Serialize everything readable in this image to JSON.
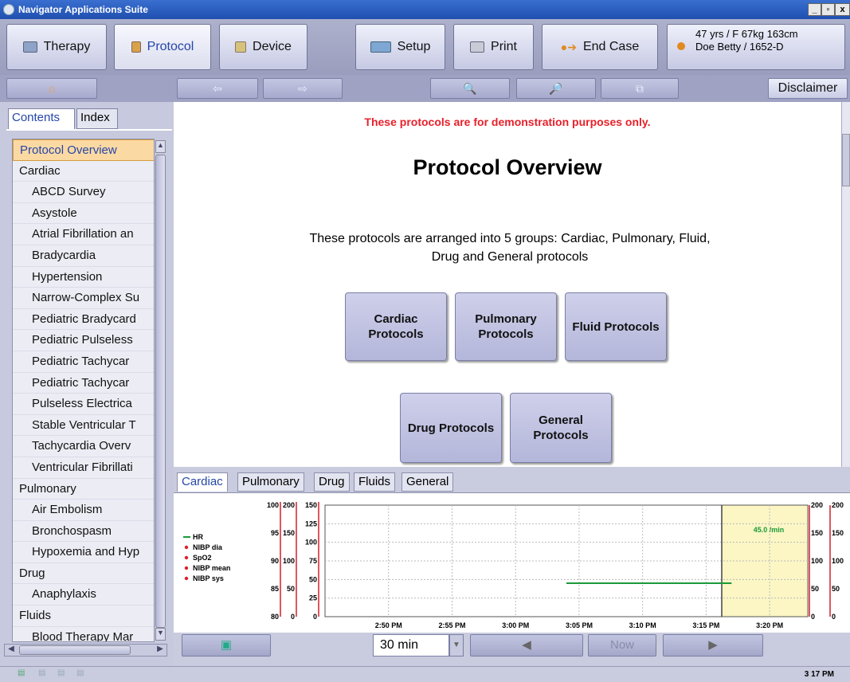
{
  "window": {
    "title": "Navigator Applications Suite"
  },
  "toolbar": {
    "therapy": "Therapy",
    "protocol": "Protocol",
    "device": "Device",
    "setup": "Setup",
    "print": "Print",
    "end_case": "End Case"
  },
  "patient": {
    "line1": "47 yrs / F  67kg  163cm",
    "line2": "Doe Betty / 1652-D"
  },
  "nav": {
    "disclaimer": "Disclaimer"
  },
  "left_tabs": {
    "contents": "Contents",
    "index": "Index"
  },
  "tree": [
    {
      "label": "Protocol Overview",
      "level": 0,
      "selected": true
    },
    {
      "label": "Cardiac",
      "level": 0
    },
    {
      "label": "ABCD Survey",
      "level": 1
    },
    {
      "label": "Asystole",
      "level": 1
    },
    {
      "label": "Atrial Fibrillation an",
      "level": 1
    },
    {
      "label": "Bradycardia",
      "level": 1
    },
    {
      "label": "Hypertension",
      "level": 1
    },
    {
      "label": "Narrow-Complex Su",
      "level": 1
    },
    {
      "label": "Pediatric Bradycard",
      "level": 1
    },
    {
      "label": "Pediatric Pulseless",
      "level": 1
    },
    {
      "label": "Pediatric Tachycar",
      "level": 1
    },
    {
      "label": "Pediatric Tachycar",
      "level": 1
    },
    {
      "label": "Pulseless Electrica",
      "level": 1
    },
    {
      "label": "Stable Ventricular T",
      "level": 1
    },
    {
      "label": "Tachycardia Overv",
      "level": 1
    },
    {
      "label": "Ventricular Fibrillati",
      "level": 1
    },
    {
      "label": "Pulmonary",
      "level": 0
    },
    {
      "label": "Air Embolism",
      "level": 1
    },
    {
      "label": "Bronchospasm",
      "level": 1
    },
    {
      "label": "Hypoxemia and Hyp",
      "level": 1
    },
    {
      "label": "Drug",
      "level": 0
    },
    {
      "label": "Anaphylaxis",
      "level": 1
    },
    {
      "label": "Fluids",
      "level": 0
    },
    {
      "label": "Blood Therapy Mar",
      "level": 1
    }
  ],
  "content": {
    "demo_notice": "These protocols are for demonstration purposes only.",
    "title": "Protocol Overview",
    "description": "These protocols are arranged into 5 groups: Cardiac, Pulmonary, Fluid, Drug and General protocols",
    "groups": {
      "cardiac": "Cardiac Protocols",
      "pulmonary": "Pulmonary Protocols",
      "fluid": "Fluid Protocols",
      "drug": "Drug Protocols",
      "general": "General Protocols"
    }
  },
  "graph_tabs": {
    "cardiac": "Cardiac",
    "pulmonary": "Pulmonary",
    "drug": "Drug",
    "fluids": "Fluids",
    "general": "General"
  },
  "chart_data": {
    "type": "line",
    "x_ticks": [
      "2:50 PM",
      "2:55 PM",
      "3:00 PM",
      "3:05 PM",
      "3:10 PM",
      "3:15 PM",
      "3:20 PM"
    ],
    "legend": [
      "HR",
      "NIBP dia",
      "SpO2",
      "NIBP mean",
      "NIBP sys"
    ],
    "legend_colors": [
      "#1b9a3a",
      "#e0202a",
      "#e0202a",
      "#e0202a",
      "#e0202a"
    ],
    "axis_spo2": [
      "100",
      "95",
      "90",
      "85",
      "80"
    ],
    "axis_nibp": [
      "200",
      "150",
      "100",
      "50",
      "0"
    ],
    "axis_hr": [
      "150",
      "125",
      "100",
      "75",
      "50",
      "25",
      "0"
    ],
    "right_axis_a": [
      "200",
      "150",
      "100",
      "50",
      "0"
    ],
    "right_axis_b": [
      "200",
      "150",
      "100",
      "50",
      "0"
    ],
    "hr_series": {
      "name": "HR",
      "x_start": "3:04 PM",
      "x_end": "3:17 PM",
      "value": 45
    },
    "current_value": "45.0 /min"
  },
  "bottom": {
    "range": "30 min",
    "now": "Now"
  },
  "status": {
    "clock": "3 17 PM"
  }
}
